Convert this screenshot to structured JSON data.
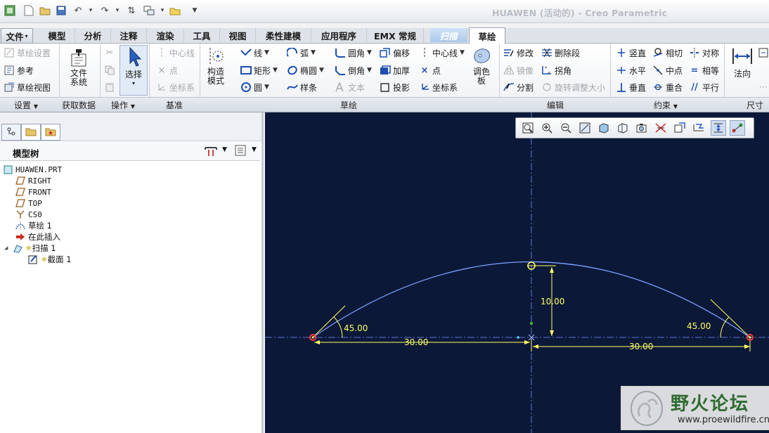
{
  "window": {
    "title": "HUAWEN (活动的) - Creo Parametric"
  },
  "tabs": [
    {
      "label": "文件"
    },
    {
      "label": "模型"
    },
    {
      "label": "分析"
    },
    {
      "label": "注释"
    },
    {
      "label": "渲染"
    },
    {
      "label": "工具"
    },
    {
      "label": "视图"
    },
    {
      "label": "柔性建模"
    },
    {
      "label": "应用程序"
    },
    {
      "label": "EMX 常规"
    },
    {
      "label": "扫描"
    },
    {
      "label": "草绘"
    }
  ],
  "ribbon": {
    "setup": {
      "items": [
        "草绘设置",
        "参考",
        "草绘视图"
      ],
      "group_label": "设置"
    },
    "get_data": {
      "file_system_label": "文件\n系统",
      "group_label": "获取数据"
    },
    "operations": {
      "select_label": "选择",
      "group_label": "操作"
    },
    "datum": {
      "items": [
        "中心线",
        "点",
        "坐标系"
      ],
      "group_label": "基准"
    },
    "sketch": {
      "construction_mode_label": "构造\n模式",
      "col1": [
        "线",
        "矩形",
        "圆"
      ],
      "col2": [
        "弧",
        "椭圆",
        "样条"
      ],
      "col3": [
        "圆角",
        "倒角",
        "文本"
      ],
      "col4": [
        "偏移",
        "加厚",
        "投影"
      ],
      "col5": [
        "中心线",
        "点",
        "坐标系"
      ],
      "palette_label": "调色\n板",
      "group_label": "草绘"
    },
    "edit": {
      "col1": [
        "修改",
        "镜像",
        "分割"
      ],
      "col2": [
        "删除段",
        "拐角",
        "旋转调整大小"
      ],
      "group_label": "编辑"
    },
    "constrain": {
      "col1": [
        "竖直",
        "水平",
        "垂直"
      ],
      "col2": [
        "相切",
        "中点",
        "重合"
      ],
      "col3": [
        "对称",
        "相等",
        "平行"
      ],
      "group_label": "约束"
    },
    "dimension": {
      "normal_label": "法向",
      "group_label": "尺寸"
    }
  },
  "model_tree": {
    "title": "模型树",
    "items": [
      {
        "label": "HUAWEN.PRT",
        "icon": "part-icon"
      },
      {
        "label": "RIGHT",
        "icon": "datum-plane-icon"
      },
      {
        "label": "FRONT",
        "icon": "datum-plane-icon"
      },
      {
        "label": "TOP",
        "icon": "datum-plane-icon"
      },
      {
        "label": "CS0",
        "icon": "coordinate-system-icon"
      },
      {
        "label": "草绘 1",
        "icon": "sketch-icon"
      },
      {
        "label": "在此插入",
        "icon": "insert-here-icon"
      },
      {
        "label": "扫描 1",
        "icon": "sweep-icon"
      },
      {
        "label": "截面 1",
        "icon": "section-icon"
      }
    ]
  },
  "sketch_dims": {
    "angle_left": "45.00",
    "angle_right": "45.00",
    "height": "10.00",
    "width_left": "30.00",
    "width_right": "30.00"
  },
  "watermark": {
    "name": "野火论坛",
    "url": "www.proewildfire.cn"
  },
  "colors": {
    "canvas_bg": "#0c1837",
    "sketch_line": "#7aa0ff",
    "dimension": "#ffff66",
    "axis": "#5a73d8"
  }
}
